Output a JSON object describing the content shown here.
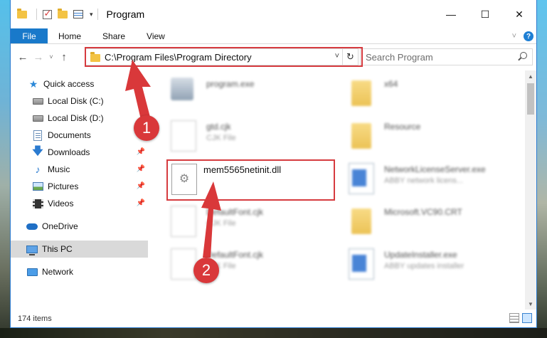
{
  "window": {
    "title": "Program",
    "controls": {
      "minimize": "—",
      "maximize": "☐",
      "close": "✕"
    }
  },
  "ribbon": {
    "tabs": [
      "File",
      "Home",
      "Share",
      "View"
    ],
    "expand_glyph": "˅"
  },
  "navigation": {
    "back": "←",
    "forward": "→",
    "recent": "˅",
    "up": "↑",
    "address": "C:\\Program Files\\Program Directory",
    "refresh": "↻",
    "search_placeholder": "Search Program"
  },
  "sidebar": {
    "items": [
      {
        "label": "Quick access",
        "icon": "star-icon"
      },
      {
        "label": "Local Disk (C:)",
        "icon": "disk-icon"
      },
      {
        "label": "Local Disk (D:)",
        "icon": "disk-icon"
      },
      {
        "label": "Documents",
        "icon": "documents-icon"
      },
      {
        "label": "Downloads",
        "icon": "downloads-icon",
        "pinned": true
      },
      {
        "label": "Music",
        "icon": "music-icon",
        "pinned": true
      },
      {
        "label": "Pictures",
        "icon": "pictures-icon",
        "pinned": true
      },
      {
        "label": "Videos",
        "icon": "videos-icon",
        "pinned": true
      },
      {
        "label": "OneDrive",
        "icon": "cloud-icon"
      },
      {
        "label": "This PC",
        "icon": "pc-icon",
        "selected": true
      },
      {
        "label": "Network",
        "icon": "network-icon"
      }
    ],
    "pin_glyph": "📌"
  },
  "files": {
    "left": [
      {
        "name": "program.exe",
        "type": ""
      },
      {
        "name": "gtd.cjk",
        "type": "CJK File"
      },
      {
        "name": "DefaultFont.cjk",
        "type": "CJK File"
      },
      {
        "name": "DefaultFont.cjk",
        "type": "CJK File"
      }
    ],
    "right": [
      {
        "name": "x64",
        "type": ""
      },
      {
        "name": "Resource",
        "type": ""
      },
      {
        "name": "NetworkLicenseServer.exe",
        "type": "ABBY network licens..."
      },
      {
        "name": "Microsoft.VC90.CRT",
        "type": ""
      },
      {
        "name": "UpdateInstaller.exe",
        "type": "ABBY updates installer"
      }
    ],
    "highlighted": {
      "name": "mem5565netinit.dll"
    }
  },
  "status": {
    "item_count": "174 items"
  },
  "callouts": {
    "one": "1",
    "two": "2"
  },
  "colors": {
    "accent": "#1979ca",
    "highlight": "#d63b3f"
  }
}
